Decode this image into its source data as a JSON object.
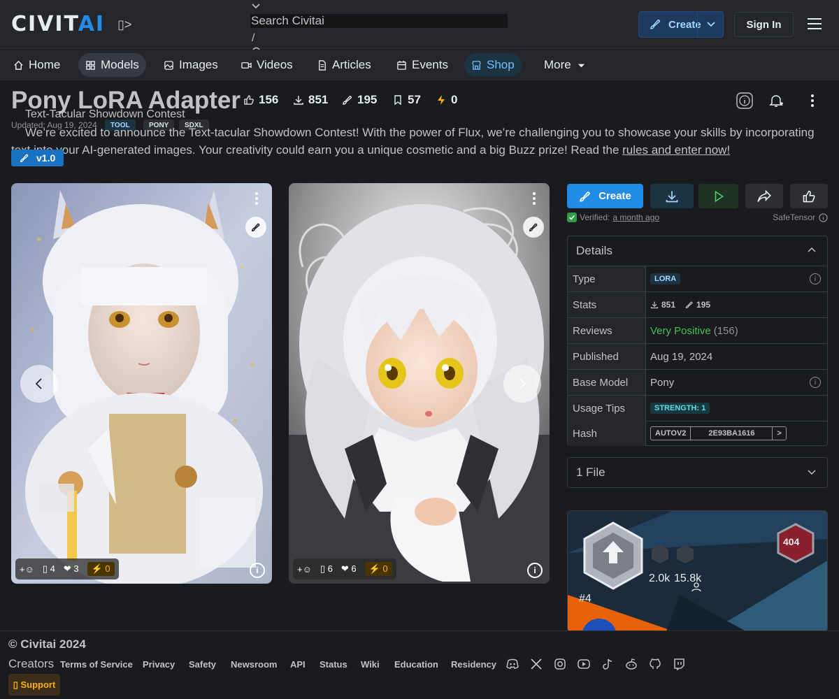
{
  "header": {
    "logo_main": "CIVIT",
    "logo_accent": "AI",
    "logo_arrow": "▯>",
    "search_placeholder": "Search Civitai",
    "search_slash": "/",
    "create_label": "Create",
    "signin_label": "Sign In"
  },
  "nav": {
    "items": [
      {
        "label": "Home",
        "icon": "home-icon"
      },
      {
        "label": "Models",
        "icon": "grid-icon"
      },
      {
        "label": "Images",
        "icon": "image-icon"
      },
      {
        "label": "Videos",
        "icon": "video-icon"
      },
      {
        "label": "Articles",
        "icon": "document-icon"
      },
      {
        "label": "Events",
        "icon": "calendar-icon"
      },
      {
        "label": "Shop",
        "icon": "shop-icon"
      },
      {
        "label": "More",
        "icon": "caret-down-icon"
      }
    ]
  },
  "model": {
    "title": "Pony LoRA Adapter",
    "stats": {
      "likes": "156",
      "downloads": "851",
      "generations": "195",
      "bookmarks": "57",
      "buzz": "0"
    },
    "updated": "Updated: Aug 19, 2024",
    "tags": [
      "TOOL",
      "PONY",
      "SDXL"
    ],
    "version": "v1.0"
  },
  "contest": {
    "title": "Text-Tacular Showdown Contest",
    "body": "We’re excited to announce the Text-tacular Showdown Contest! With the power of Flux, we’re challenging you to showcase your skills by incorporating text into your AI-generated images. Your creativity could earn you a unique cosmetic and a big Buzz prize! Read the ",
    "link": "rules and enter now!"
  },
  "images": [
    {
      "reaction_add": "+☺",
      "comments": "▯ 4",
      "hearts": "❤ 3",
      "buzz": "⚡ 0",
      "info": "i"
    },
    {
      "reaction_add": "+☺",
      "comments": "▯ 6",
      "hearts": "❤ 6",
      "buzz": "⚡ 0",
      "info": "i"
    }
  ],
  "actions": {
    "create_label": "Create",
    "verified_prefix": "Verified: ",
    "verified_time": "a month ago",
    "safetensor": "SafeTensor"
  },
  "details": {
    "heading": "Details",
    "rows": {
      "type": {
        "key": "Type",
        "value": "LORA"
      },
      "stats": {
        "key": "Stats",
        "downloads": "851",
        "generations": "195"
      },
      "reviews": {
        "key": "Reviews",
        "value": "Very Positive",
        "count": "(156)"
      },
      "published": {
        "key": "Published",
        "value": "Aug 19, 2024"
      },
      "base_model": {
        "key": "Base Model",
        "value": "Pony"
      },
      "usage_tips": {
        "key": "Usage Tips",
        "value": "STRENGTH: 1"
      },
      "hash": {
        "key": "Hash",
        "algo": "AUTOV2",
        "value": "2E93BA1616",
        "arrow": ">"
      }
    }
  },
  "files": {
    "label": "1 File"
  },
  "creator_card": {
    "badge": "404",
    "count_a": "2.0k",
    "count_b": "15.8k",
    "rank": "#4"
  },
  "footer": {
    "copyright": "© Civitai 2024",
    "creators": "Creators",
    "links": [
      "Terms of Service",
      "Privacy",
      "Safety",
      "Newsroom",
      "API",
      "Status",
      "Wiki",
      "Education",
      "Residency"
    ],
    "support": "▯ Support"
  },
  "colors": {
    "accent": "#228be6",
    "background": "#1a1b1e",
    "positive": "#40c057",
    "buzz": "#fab005"
  }
}
